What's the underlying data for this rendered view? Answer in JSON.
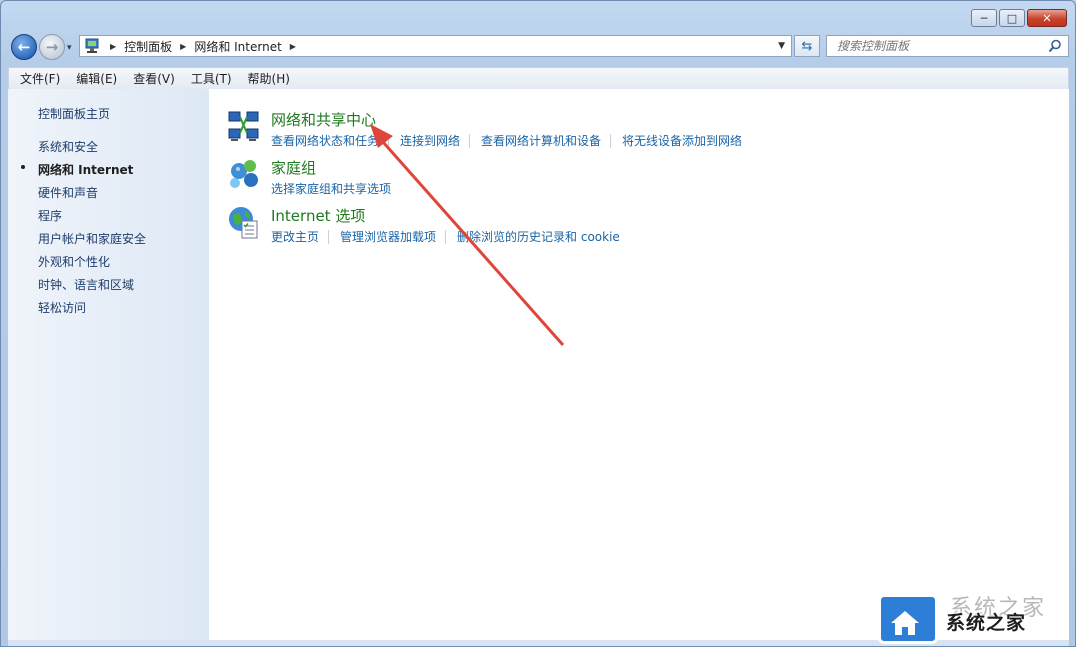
{
  "window": {
    "minimize_label": "─",
    "maximize_label": "□",
    "close_label": "✕"
  },
  "address_bar": {
    "breadcrumbs": [
      "控制面板",
      "网络和 Internet"
    ]
  },
  "search": {
    "placeholder": "搜索控制面板"
  },
  "menu": [
    "文件(F)",
    "编辑(E)",
    "查看(V)",
    "工具(T)",
    "帮助(H)"
  ],
  "sidebar": {
    "home": "控制面板主页",
    "items": [
      {
        "label": "系统和安全",
        "active": false
      },
      {
        "label": "网络和 Internet",
        "active": true
      },
      {
        "label": "硬件和声音",
        "active": false
      },
      {
        "label": "程序",
        "active": false
      },
      {
        "label": "用户帐户和家庭安全",
        "active": false
      },
      {
        "label": "外观和个性化",
        "active": false
      },
      {
        "label": "时钟、语言和区域",
        "active": false
      },
      {
        "label": "轻松访问",
        "active": false
      }
    ]
  },
  "groups": [
    {
      "title": "网络和共享中心",
      "icon": "network-sharing-center-icon",
      "links": [
        "查看网络状态和任务",
        "连接到网络",
        "查看网络计算机和设备",
        "将无线设备添加到网络"
      ]
    },
    {
      "title": "家庭组",
      "icon": "homegroup-icon",
      "links": [
        "选择家庭组和共享选项"
      ]
    },
    {
      "title": "Internet 选项",
      "icon": "internet-options-icon",
      "links": [
        "更改主页",
        "管理浏览器加载项",
        "删除浏览的历史记录和 cookie"
      ]
    }
  ],
  "watermark": {
    "text": "系统之家"
  },
  "colors": {
    "link": "#1b64a6",
    "group_title": "#1f7a1f",
    "annotation_arrow": "#e0453a"
  }
}
